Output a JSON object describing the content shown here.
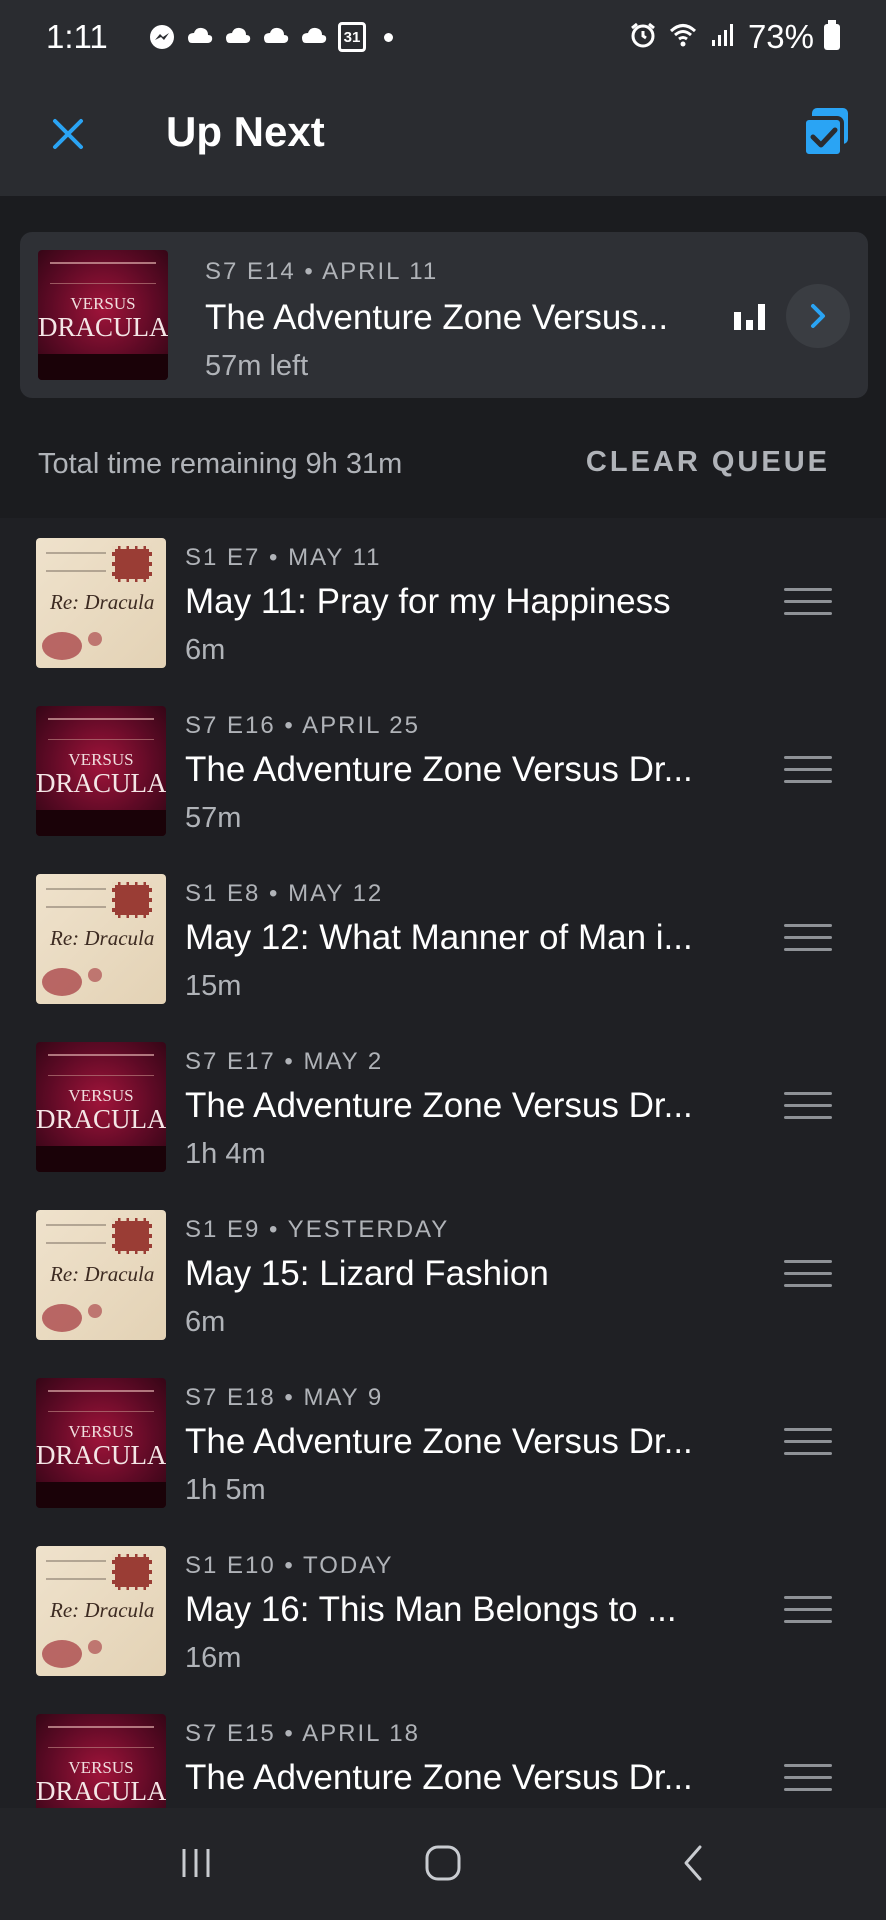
{
  "status_bar": {
    "time": "1:11",
    "calendar_day": "31",
    "battery": "73%",
    "icons": [
      "messenger-icon",
      "cloud-icon",
      "cloud-icon",
      "cloud-icon",
      "cloud-icon",
      "calendar-icon",
      "alarm-icon",
      "wifi-icon",
      "signal-icon",
      "battery-icon"
    ]
  },
  "header": {
    "title": "Up Next",
    "close_icon": "close-icon",
    "multi_select_icon": "multi-select-icon",
    "accent": "#2aa4f4"
  },
  "now_playing": {
    "art": "dracula",
    "meta": "S7 E14 • APRIL 11",
    "title": "The Adventure Zone Versus...",
    "remaining": "57m left"
  },
  "queue_summary": {
    "total": "Total time remaining 9h 31m",
    "clear_label": "CLEAR QUEUE"
  },
  "artwork_text": {
    "dracula_top": "VERSUS",
    "dracula_main": "DRACULA",
    "letter_sig": "Re: Dracula"
  },
  "queue": [
    {
      "art": "letter",
      "meta": "S1 E7 • MAY 11",
      "title": "May 11: Pray for my Happiness",
      "duration": "6m"
    },
    {
      "art": "dracula",
      "meta": "S7 E16 • APRIL 25",
      "title": "The Adventure Zone Versus Dr...",
      "duration": "57m"
    },
    {
      "art": "letter",
      "meta": "S1 E8 • MAY 12",
      "title": "May 12: What Manner of Man i...",
      "duration": "15m"
    },
    {
      "art": "dracula",
      "meta": "S7 E17 • MAY 2",
      "title": "The Adventure Zone Versus Dr...",
      "duration": "1h 4m"
    },
    {
      "art": "letter",
      "meta": "S1 E9 • YESTERDAY",
      "title": "May 15: Lizard Fashion",
      "duration": "6m"
    },
    {
      "art": "dracula",
      "meta": "S7 E18 • MAY 9",
      "title": "The Adventure Zone Versus Dr...",
      "duration": "1h 5m"
    },
    {
      "art": "letter",
      "meta": "S1 E10 • TODAY",
      "title": "May 16: This Man Belongs to ...",
      "duration": "16m"
    },
    {
      "art": "dracula",
      "meta": "S7 E15 • APRIL 18",
      "title": "The Adventure Zone Versus Dr...",
      "duration": ""
    }
  ],
  "nav": {
    "recents_icon": "recents-icon",
    "home_icon": "home-icon",
    "back_icon": "back-icon"
  }
}
